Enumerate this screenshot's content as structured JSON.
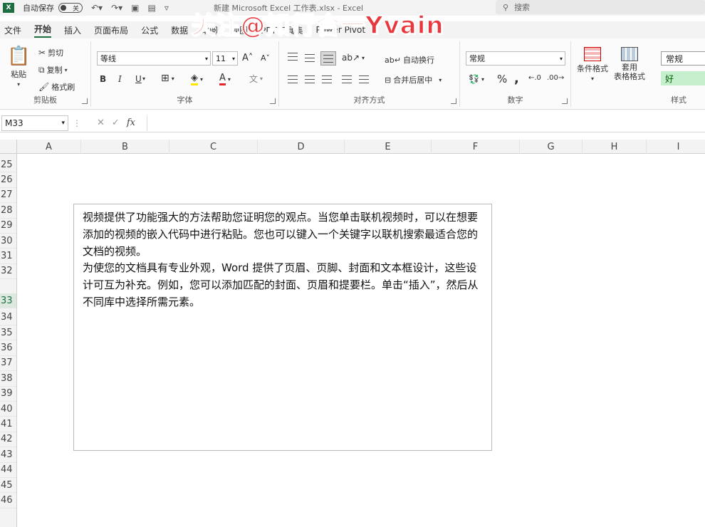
{
  "titlebar": {
    "autosave_label": "自动保存",
    "autosave_state": "关",
    "filename": "新建 Microsoft Excel 工作表.xlsx - Excel",
    "search_placeholder": "搜索"
  },
  "watermark": "关注@知行合一Yvain",
  "menu": [
    "文件",
    "开始",
    "插入",
    "页面布局",
    "公式",
    "数据",
    "审阅",
    "视图",
    "PDF工具集",
    "Power Pivot"
  ],
  "ribbon": {
    "clipboard": {
      "paste": "粘贴",
      "cut": "剪切",
      "copy": "复制",
      "format_painter": "格式刷",
      "label": "剪贴板"
    },
    "font": {
      "font_name": "等线",
      "font_size": "11",
      "label": "字体",
      "bold": "B",
      "italic": "I",
      "underline": "U"
    },
    "alignment": {
      "wrap": "自动换行",
      "merge": "合并后居中",
      "label": "对齐方式"
    },
    "number": {
      "format": "常规",
      "percent": "%",
      "comma": ",",
      "label": "数字"
    },
    "styles": {
      "conditional": "条件格式",
      "table_format": "套用\n表格格式",
      "normal": "常规",
      "good": "好",
      "label": "样式"
    }
  },
  "formula": {
    "name_box": "M33",
    "fx": "fx",
    "value": ""
  },
  "columns": [
    "A",
    "B",
    "C",
    "D",
    "E",
    "F",
    "G",
    "H",
    "I"
  ],
  "rows": [
    "25",
    "26",
    "27",
    "28",
    "29",
    "30",
    "31",
    "32",
    "33",
    "34",
    "35",
    "36",
    "37",
    "38",
    "39",
    "40",
    "41",
    "42",
    "43",
    "44",
    "45",
    "46"
  ],
  "selected_row": "33",
  "textbox": {
    "para1": "视频提供了功能强大的方法帮助您证明您的观点。当您单击联机视频时，可以在想要添加的视频的嵌入代码中进行粘贴。您也可以键入一个关键字以联机搜索最适合您的文档的视频。",
    "para2": "为使您的文档具有专业外观，Word 提供了页眉、页脚、封面和文本框设计，这些设计可互为补充。例如，您可以添加匹配的封面、页眉和提要栏。单击“插入”，然后从不同库中选择所需元素。"
  },
  "colors": {
    "accent": "#1d6f42",
    "watermark": "#e8383d",
    "good_fill": "#c6efce"
  }
}
